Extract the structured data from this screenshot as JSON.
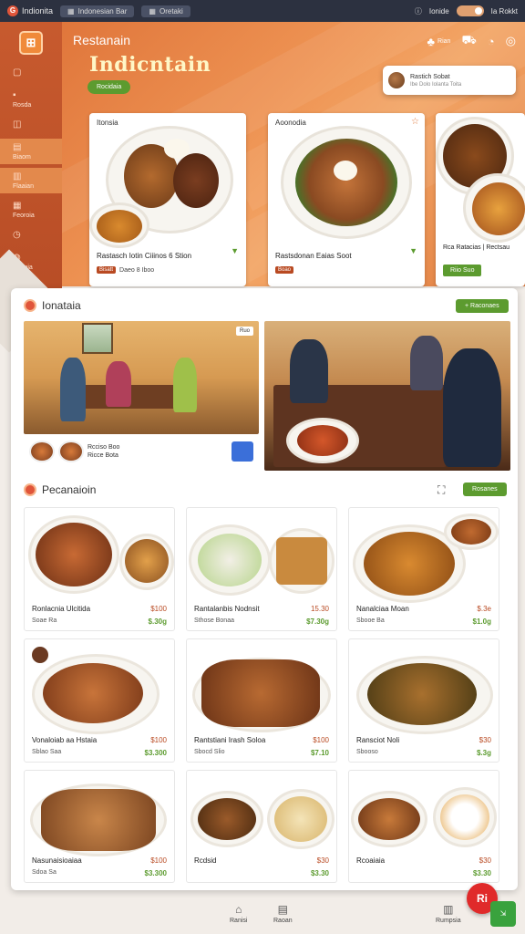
{
  "topbar": {
    "brand": "Indionita",
    "tabs": [
      "Indonesian Bar",
      "Oretaki"
    ],
    "right_label_1": "Ionide",
    "right_label_2": "Ia Rokkt"
  },
  "sidebar": {
    "items": [
      {
        "label": "",
        "icon": "cart-icon"
      },
      {
        "label": "Rosda",
        "icon": "grid-icon"
      },
      {
        "label": "",
        "icon": "bag-icon"
      },
      {
        "label": "Biaom",
        "icon": "doc-icon"
      },
      {
        "label": "Flaaian",
        "icon": "chart-icon"
      },
      {
        "label": "Feoroia",
        "icon": "list-icon"
      },
      {
        "label": "",
        "icon": "clock-icon"
      },
      {
        "label": "Edonia",
        "icon": "user-icon"
      },
      {
        "label": "",
        "icon": "settings-icon"
      }
    ]
  },
  "hero": {
    "app_name": "Restanain",
    "title": "Indicntain",
    "button": "Rocidaia",
    "head_icons": [
      {
        "label": "Rian",
        "icon": "bell-icon"
      },
      {
        "label": "",
        "icon": "cart-icon"
      },
      {
        "label": "",
        "icon": "clock-icon"
      },
      {
        "label": "",
        "icon": "help-icon"
      }
    ],
    "profile": {
      "name": "Rastich Sobat",
      "sub": "Ibe Dolo Iolanta Toita"
    }
  },
  "featured": [
    {
      "title": "Itonsia",
      "name": "Rastasch Iotin Ciiinos 6 Stion",
      "price": "Bisatt",
      "price2": "Daeo 8 Iboo"
    },
    {
      "title": "Aoonodia",
      "name": "Rastsdonan Eaias Soot",
      "price": "Boao",
      "price2": ""
    },
    {
      "title": "",
      "name": "Rca Ratacias | Rectsau",
      "price": "Riio Suo",
      "price2": ""
    }
  ],
  "dining": {
    "title": "Ionataia",
    "button": "Raconaes",
    "badge": "Ruo",
    "foot_line1": "Rcciso Boo",
    "foot_line2": "Ricce Bota"
  },
  "menu": {
    "title": "Pecanaioin",
    "button": "Rosanes",
    "items": [
      {
        "name": "Ronlacnia Ulcitida",
        "price1": "$100",
        "sub": "Soae Ra",
        "price2": "$.30g"
      },
      {
        "name": "Rantalanbis Nodnsit",
        "price1": "15.30",
        "sub": "Sthose Bonaa",
        "price2": "$7.30g"
      },
      {
        "name": "Nanalciaa Moan",
        "price1": "$.3e",
        "sub": "Sbooe Ba",
        "price2": "$1.0g"
      },
      {
        "name": "Vonaloiab aa Hstaia",
        "price1": "$100",
        "sub": "Sblao Saa",
        "price2": "$3.300"
      },
      {
        "name": "Rantstiani Irash Soloa",
        "price1": "$100",
        "sub": "Sbocd Slio",
        "price2": "$7.10"
      },
      {
        "name": "Ransciot Noli",
        "price1": "$30",
        "sub": "Sbooso",
        "price2": "$.3g"
      },
      {
        "name": "Nasunaisioaiaa",
        "price1": "$100",
        "sub": "Sdoa Sa",
        "price2": "$3.300"
      },
      {
        "name": "Rcdsid",
        "price1": "$30",
        "sub": "",
        "price2": "$3.30"
      },
      {
        "name": "Rcoaiaia",
        "price1": "$30",
        "sub": "",
        "price2": "$3.30"
      }
    ]
  },
  "bottomnav": {
    "items": [
      {
        "label": "Ranisi",
        "icon": "home-icon"
      },
      {
        "label": "Raoan",
        "icon": "doc-icon"
      },
      {
        "label": "Rumpsia",
        "icon": "chart-icon"
      }
    ],
    "fab": "Ri"
  },
  "colors": {
    "accent": "#e0763b",
    "green": "#5c9b2f",
    "red": "#e02a2a"
  }
}
